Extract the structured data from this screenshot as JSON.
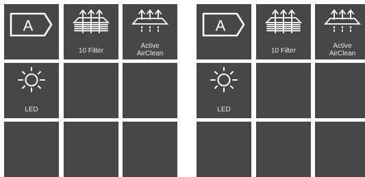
{
  "panels": [
    {
      "tiles": [
        {
          "icon": "energy-class-a-icon",
          "letter": "A",
          "label": ""
        },
        {
          "icon": "filter-stack-icon",
          "label": "10 Filter"
        },
        {
          "icon": "active-airclean-icon",
          "label_line1": "Active",
          "label_line2": "AirClean"
        },
        {
          "icon": "light-bulb-icon",
          "label": "LED"
        },
        {
          "icon": "",
          "label": ""
        },
        {
          "icon": "",
          "label": ""
        },
        {
          "icon": "",
          "label": ""
        },
        {
          "icon": "",
          "label": ""
        },
        {
          "icon": "",
          "label": ""
        }
      ]
    },
    {
      "tiles": [
        {
          "icon": "energy-class-a-icon",
          "letter": "A",
          "label": ""
        },
        {
          "icon": "filter-stack-icon",
          "label": "10 Filter"
        },
        {
          "icon": "active-airclean-icon",
          "label_line1": "Active",
          "label_line2": "AirClean"
        },
        {
          "icon": "light-bulb-icon",
          "label": "LED"
        },
        {
          "icon": "",
          "label": ""
        },
        {
          "icon": "",
          "label": ""
        },
        {
          "icon": "",
          "label": ""
        },
        {
          "icon": "",
          "label": ""
        },
        {
          "icon": "",
          "label": ""
        }
      ]
    }
  ],
  "colors": {
    "tile_background": "#474747",
    "icon_stroke": "#ffffff",
    "label_text": "#e6e6e6"
  }
}
